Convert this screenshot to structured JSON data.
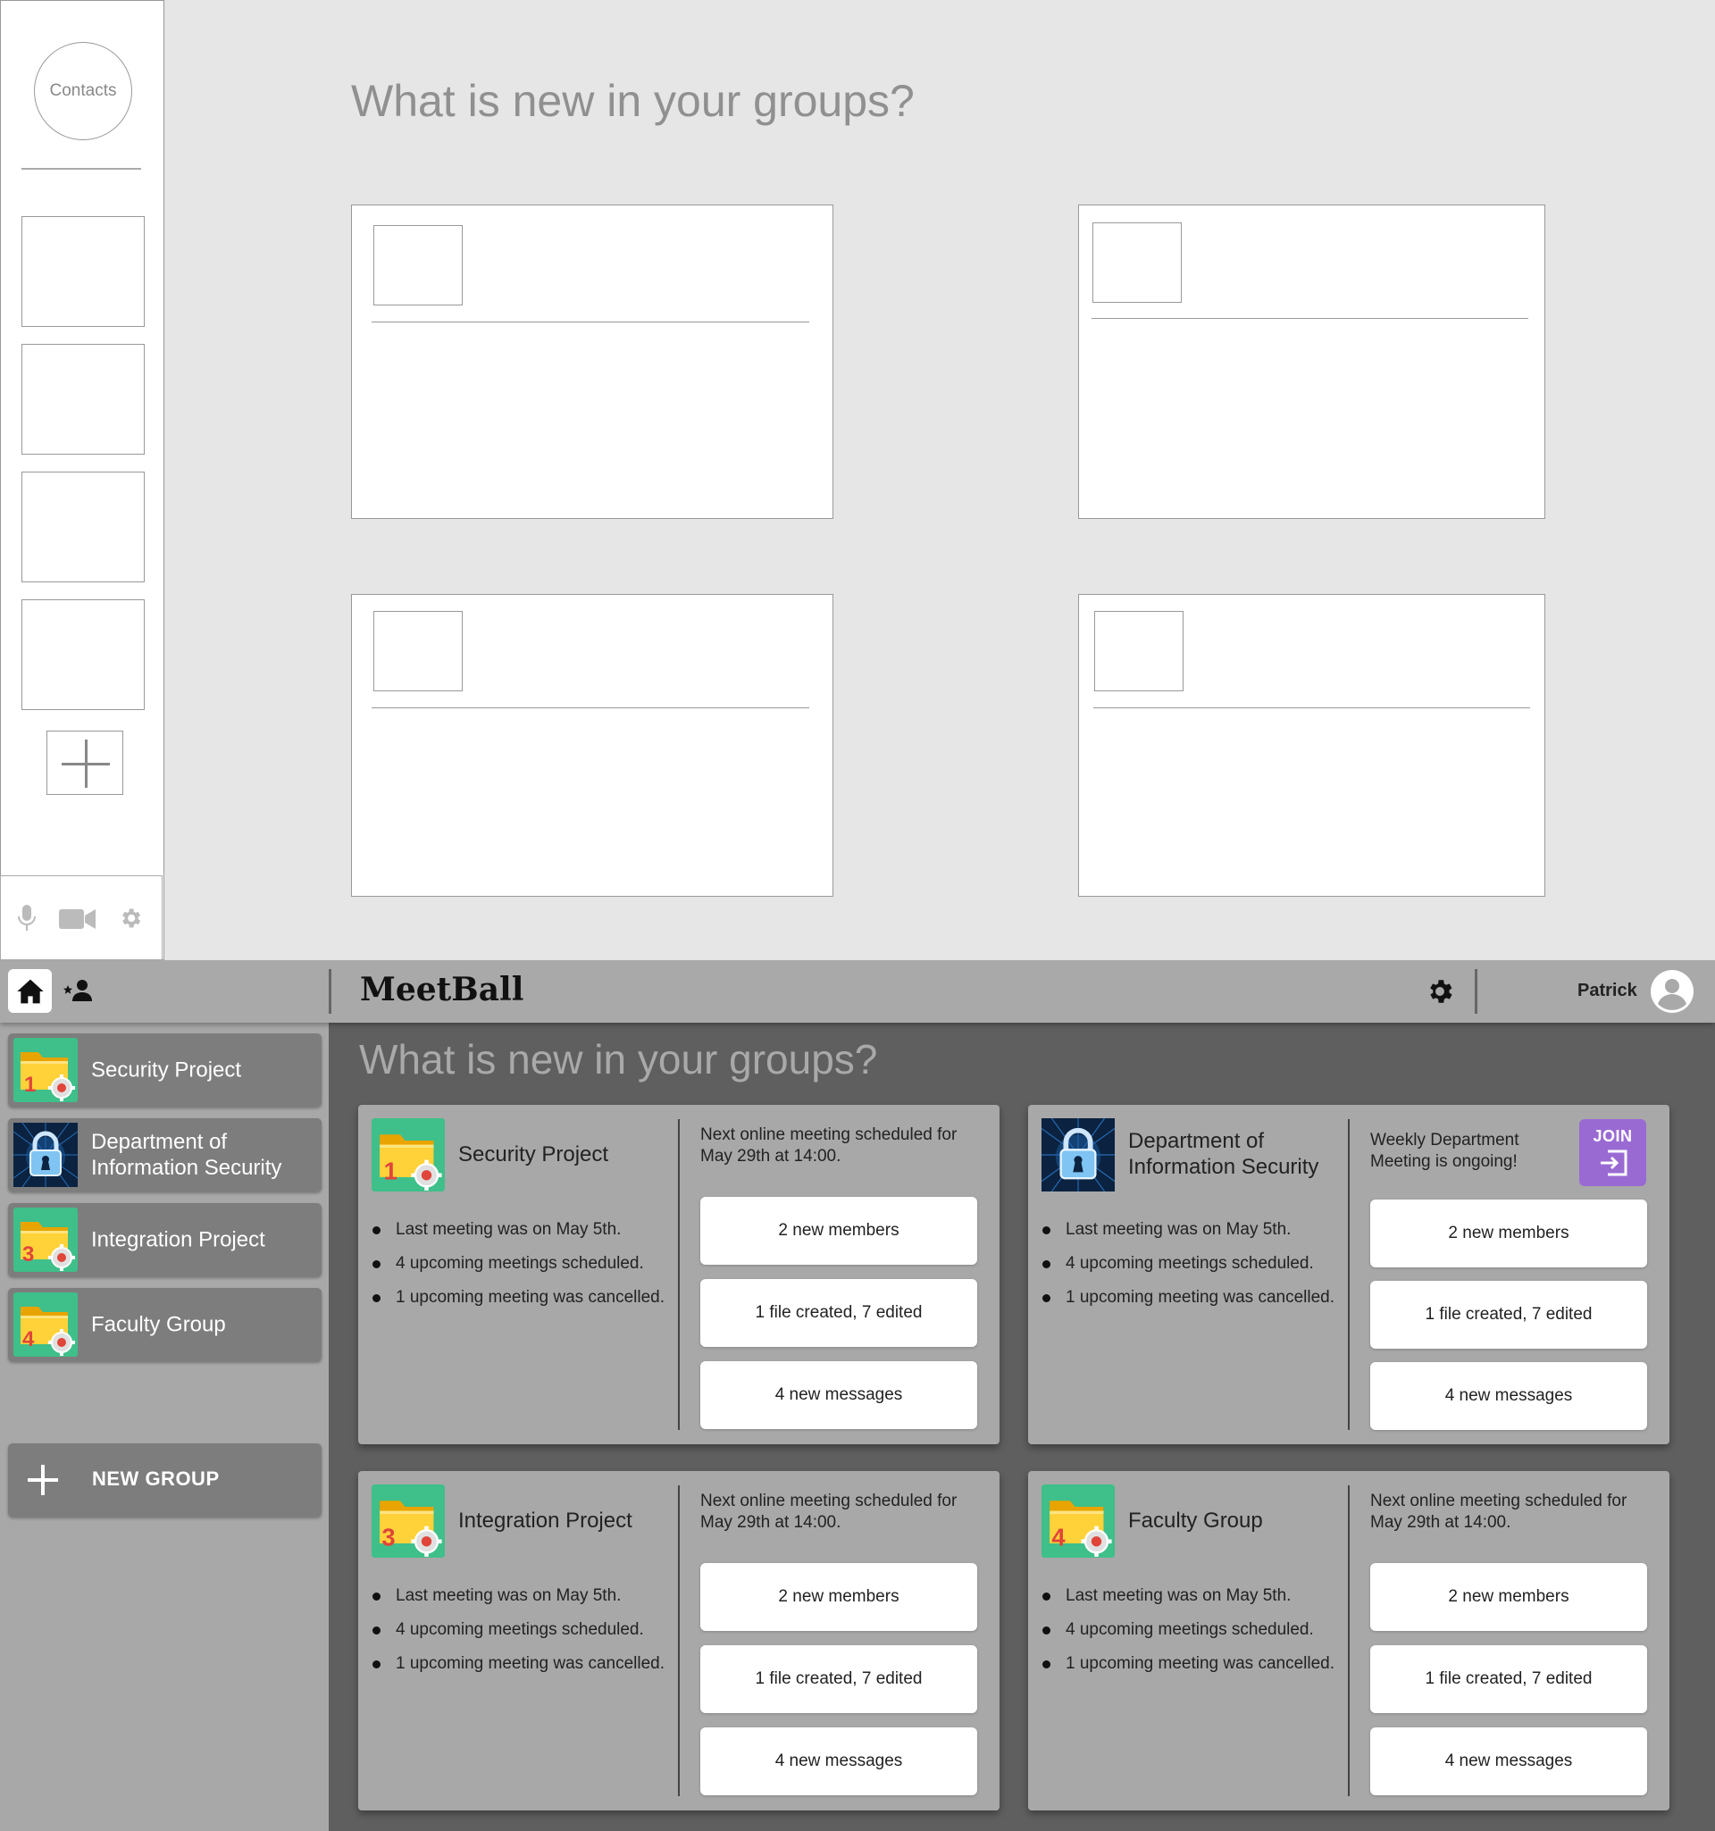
{
  "wireframe": {
    "contacts_label": "Contacts",
    "title": "What is new in your groups?"
  },
  "app": {
    "title": "MeetBall",
    "user_name": "Patrick",
    "main_title": "What is new in your groups?",
    "new_group_label": "NEW GROUP",
    "colors": {
      "topbar": "#a9a9a9",
      "sidebar": "#a8a8a8",
      "content_bg": "#5f5f5f",
      "join_button": "#9a6ad3",
      "folder_tile": "#3fbf8a"
    }
  },
  "sidebar": {
    "groups": [
      {
        "label": "Security Project",
        "icon": "folder-gear-icon",
        "badge": "1"
      },
      {
        "label": "Department of Information Security",
        "icon": "padlock-icon"
      },
      {
        "label": "Integration Project",
        "icon": "folder-gear-icon",
        "badge": "3"
      },
      {
        "label": "Faculty Group",
        "icon": "folder-gear-icon",
        "badge": "4"
      }
    ]
  },
  "cards": [
    {
      "name": "Security Project",
      "badge": "1",
      "bullets": [
        "Last meeting was on May 5th.",
        "4 upcoming meetings scheduled.",
        "1 upcoming meeting was cancelled."
      ],
      "info": "Next online meeting scheduled for May 29th at 14:00.",
      "buttons": [
        "2 new members",
        "1 file created, 7 edited",
        "4 new messages"
      ]
    },
    {
      "name": "Department of Information Security",
      "bullets": [
        "Last meeting was on May 5th.",
        "4 upcoming meetings scheduled.",
        "1 upcoming meeting was cancelled."
      ],
      "info": "Weekly Department Meeting is ongoing!",
      "join_label": "JOIN",
      "buttons": [
        "2 new members",
        "1 file created, 7 edited",
        "4 new messages"
      ]
    },
    {
      "name": "Integration Project",
      "badge": "3",
      "bullets": [
        "Last meeting was on May 5th.",
        "4 upcoming meetings scheduled.",
        "1 upcoming meeting was cancelled."
      ],
      "info": "Next online meeting scheduled for May 29th at 14:00.",
      "buttons": [
        "2 new members",
        "1 file created, 7 edited",
        "4 new messages"
      ]
    },
    {
      "name": "Faculty Group",
      "badge": "4",
      "bullets": [
        "Last meeting was on May 5th.",
        "4 upcoming meetings scheduled.",
        "1 upcoming meeting was cancelled."
      ],
      "info": "Next online meeting scheduled for May 29th at 14:00.",
      "buttons": [
        "2 new members",
        "1 file created, 7 edited",
        "4 new messages"
      ]
    }
  ]
}
